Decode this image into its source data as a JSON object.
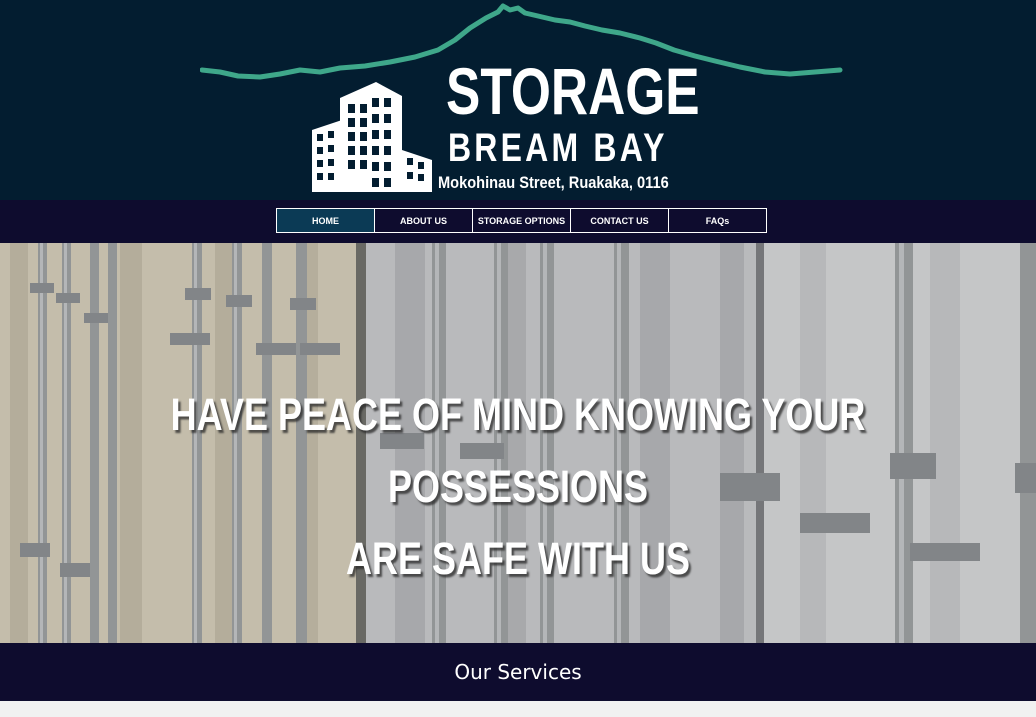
{
  "logo": {
    "title": "STORAGE",
    "subtitle": "BREAM BAY",
    "address": "Mokohinau Street, Ruakaka, 0116"
  },
  "nav": {
    "items": [
      {
        "label": "HOME",
        "active": true
      },
      {
        "label": "ABOUT US",
        "active": false
      },
      {
        "label": "STORAGE OPTIONS",
        "active": false
      },
      {
        "label": "CONTACT US",
        "active": false
      },
      {
        "label": "FAQs",
        "active": false
      }
    ]
  },
  "hero": {
    "line1": "HAVE PEACE OF MIND KNOWING YOUR POSSESSIONS",
    "line2": "ARE SAFE WITH US"
  },
  "services": {
    "title": "Our Services"
  },
  "colors": {
    "header_bg": "#031d30",
    "nav_bg": "#0e0c2e",
    "nav_active": "#0b3a55",
    "mountain": "#3fa78a"
  },
  "icons": [
    "mountain-outline-icon",
    "buildings-icon"
  ]
}
